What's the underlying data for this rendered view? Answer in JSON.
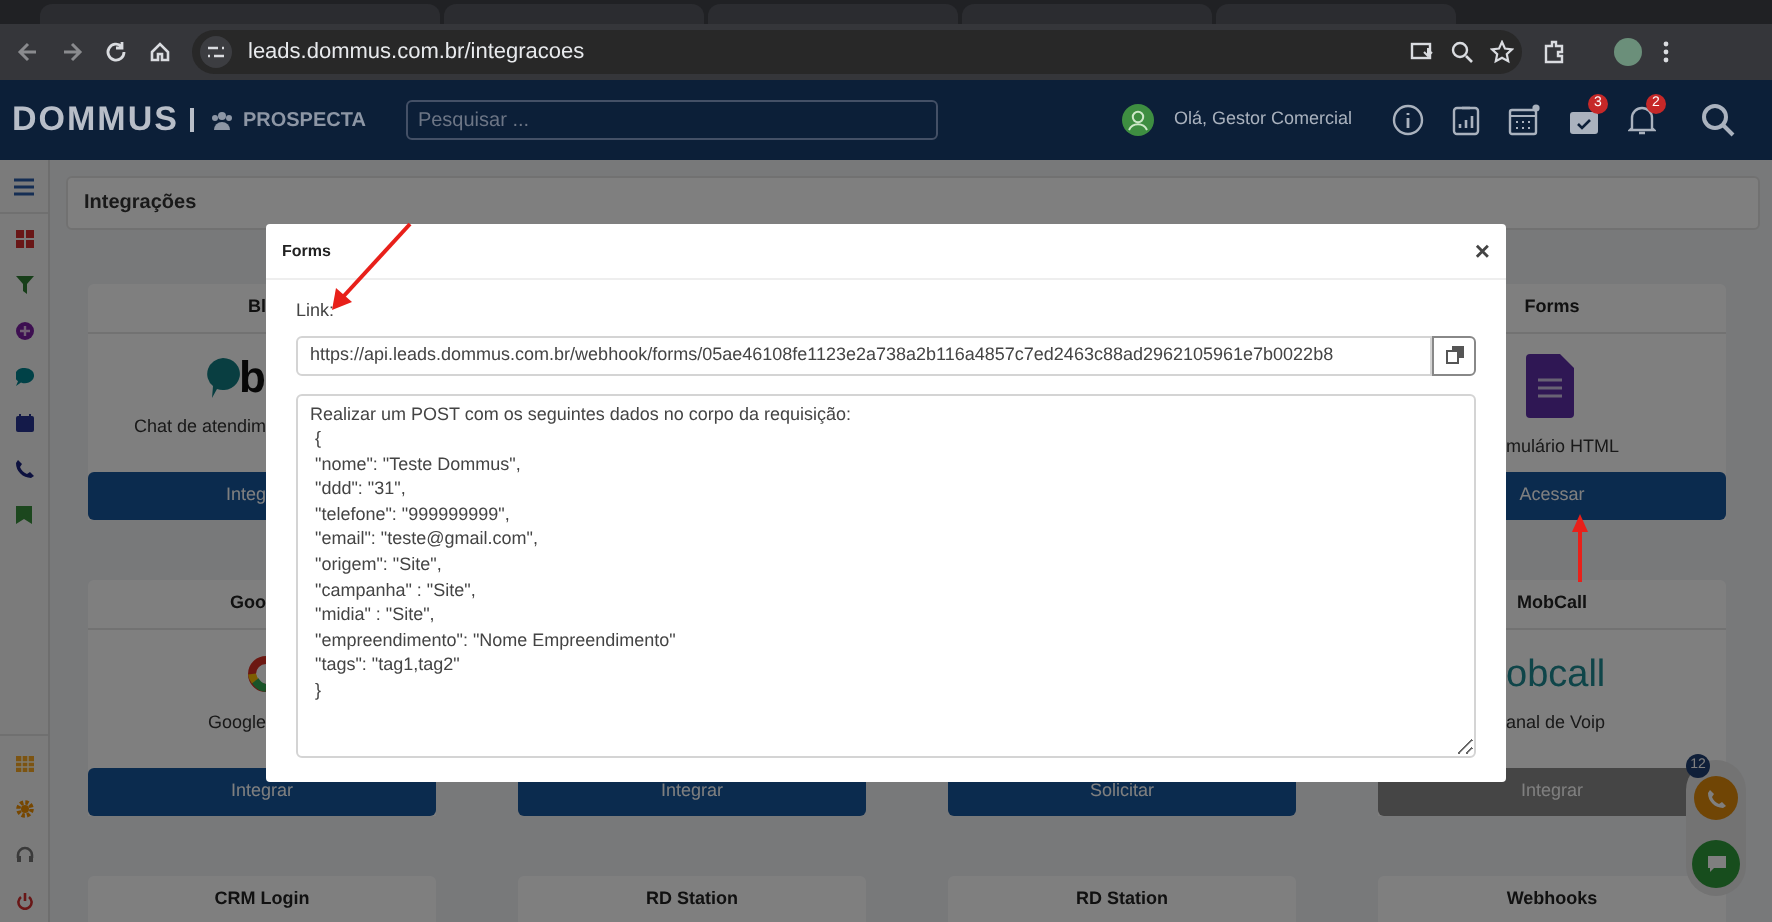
{
  "browser": {
    "url": "leads.dommus.com.br/integracoes"
  },
  "header": {
    "logo": "DOMMUS",
    "module": "PROSPECTA",
    "search_placeholder": "Pesquisar ...",
    "greeting": "Olá, Gestor Comercial",
    "badges": [
      {
        "count": "3"
      },
      {
        "count": "2"
      }
    ]
  },
  "page_title": "Integrações",
  "card_rows": [
    {
      "column_1": {
        "title": "Bl",
        "logo": "b",
        "description": "Chat de atendim",
        "button": {
          "label": "Integ",
          "disabled": false
        }
      },
      "column_4": {
        "title": "Forms",
        "description": "mulário HTML",
        "button": {
          "label": "Acessar",
          "disabled": false
        }
      }
    },
    {
      "column_1": {
        "title": "Goo",
        "description": "Google",
        "button": {
          "label": "Integrar",
          "disabled": false
        }
      },
      "column_2": {
        "button": {
          "label": "Integrar",
          "disabled": false
        }
      },
      "column_3": {
        "button": {
          "label": "Solicitar",
          "disabled": false
        }
      },
      "column_4": {
        "title": "MobCall",
        "logo": "obcall",
        "description": "anal de Voip",
        "button": {
          "label": "Integrar",
          "disabled": true
        }
      }
    },
    {
      "column_1": {
        "title": "CRM Login"
      },
      "column_2": {
        "title": "RD Station"
      },
      "column_3": {
        "title": "RD Station"
      },
      "column_4": {
        "title": "Webhooks"
      }
    }
  ],
  "modal": {
    "title": "Forms",
    "close": "×",
    "link_label": "Link:",
    "link_value": "https://api.leads.dommus.com.br/webhook/forms/05ae46108fe1123e2a738a2b116a4857c7ed2463c88ad2962105961e7b0022b8",
    "body_lines": [
      "Realizar um POST com os seguintes dados no corpo da requisição:",
      " {",
      " \"nome\": \"Teste Dommus\",",
      " \"ddd\": \"31\",",
      " \"telefone\": \"999999999\",",
      " \"email\": \"teste@gmail.com\",",
      " \"origem\": \"Site\",",
      " \"campanha\" : \"Site\",",
      " \"midia\" : \"Site\",",
      " \"empreendimento\": \"Nome Empreendimento\"",
      " \"tags\": \"tag1,tag2\"",
      " }"
    ]
  },
  "widget": {
    "badge": "12"
  }
}
